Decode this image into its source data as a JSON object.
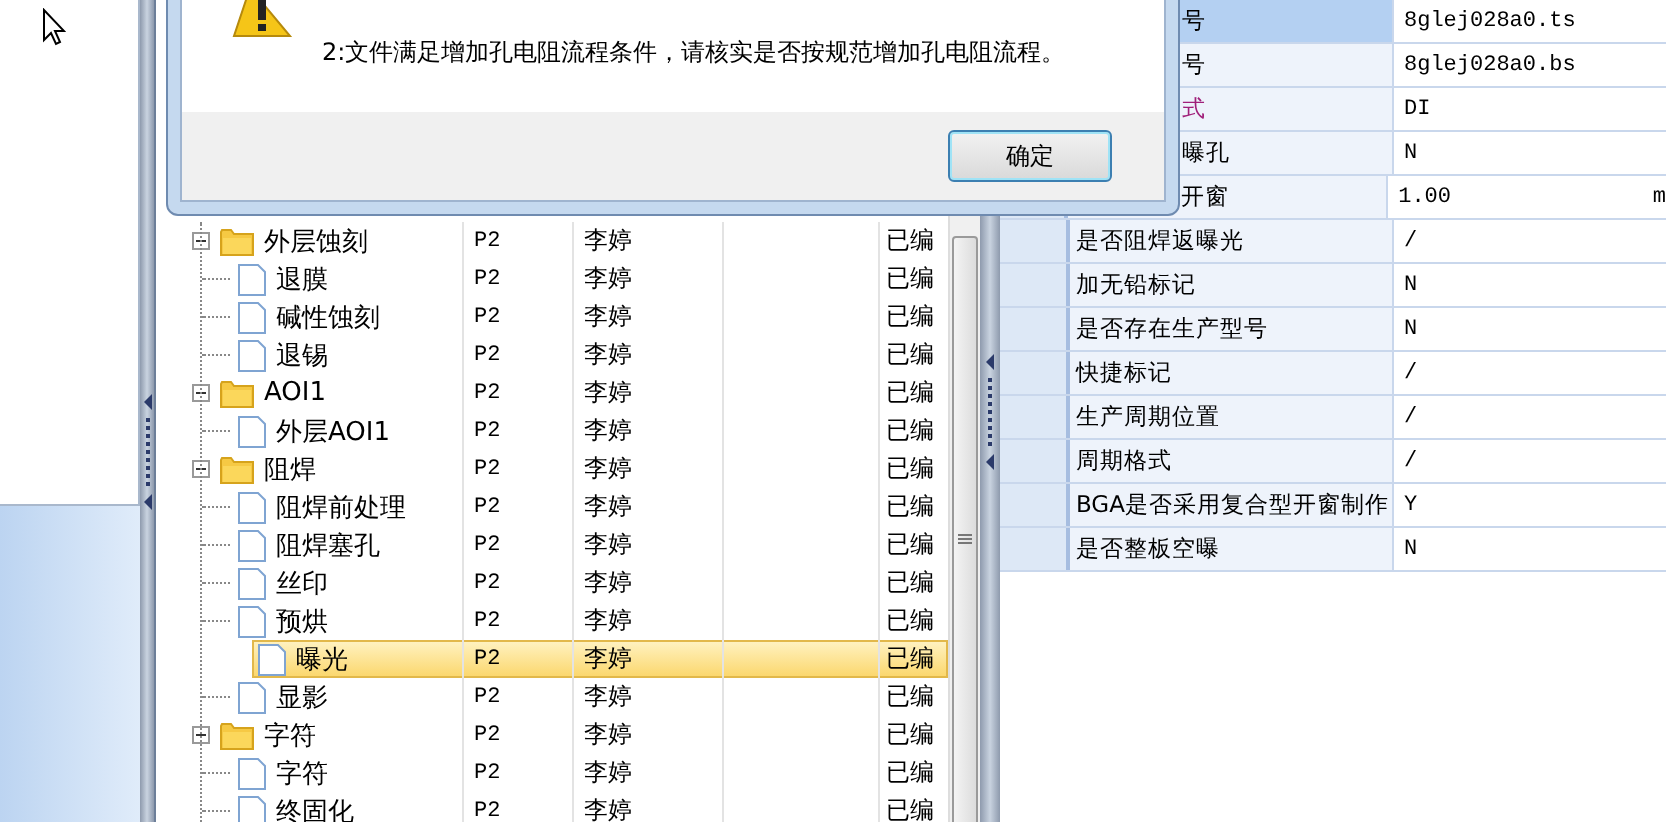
{
  "dialog": {
    "message_lines": [
      "2:文件满足增加孔电阻流程条件，请核实是否按规范增加孔电阻流程。"
    ],
    "buttons": [
      {
        "label": "确定"
      }
    ]
  },
  "tree": [
    {
      "name": "外层蚀刻",
      "layer": "P2",
      "owner": "李婷",
      "status": "已编",
      "expanded": true,
      "selected": false,
      "children": [
        {
          "name": "退膜",
          "layer": "P2",
          "owner": "李婷",
          "status": "已编",
          "selected": false
        },
        {
          "name": "碱性蚀刻",
          "layer": "P2",
          "owner": "李婷",
          "status": "已编",
          "selected": false
        },
        {
          "name": "退锡",
          "layer": "P2",
          "owner": "李婷",
          "status": "已编",
          "selected": false
        }
      ]
    },
    {
      "name": "AOI1",
      "layer": "P2",
      "owner": "李婷",
      "status": "已编",
      "expanded": true,
      "selected": false,
      "children": [
        {
          "name": "外层AOI1",
          "layer": "P2",
          "owner": "李婷",
          "status": "已编",
          "selected": false
        }
      ]
    },
    {
      "name": "阻焊",
      "layer": "P2",
      "owner": "李婷",
      "status": "已编",
      "expanded": true,
      "selected": false,
      "children": [
        {
          "name": "阻焊前处理",
          "layer": "P2",
          "owner": "李婷",
          "status": "已编",
          "selected": false
        },
        {
          "name": "阻焊塞孔",
          "layer": "P2",
          "owner": "李婷",
          "status": "已编",
          "selected": false
        },
        {
          "name": "丝印",
          "layer": "P2",
          "owner": "李婷",
          "status": "已编",
          "selected": false
        },
        {
          "name": "预烘",
          "layer": "P2",
          "owner": "李婷",
          "status": "已编",
          "selected": false
        },
        {
          "name": "曝光",
          "layer": "P2",
          "owner": "李婷",
          "status": "已编",
          "selected": true
        },
        {
          "name": "显影",
          "layer": "P2",
          "owner": "李婷",
          "status": "已编",
          "selected": false
        }
      ]
    },
    {
      "name": "字符",
      "layer": "P2",
      "owner": "李婷",
      "status": "已编",
      "expanded": true,
      "selected": false,
      "children": [
        {
          "name": "字符",
          "layer": "P2",
          "owner": "李婷",
          "status": "已编",
          "selected": false
        },
        {
          "name": "终固化",
          "layer": "P2",
          "owner": "李婷",
          "status": "已编",
          "selected": false
        }
      ]
    }
  ],
  "properties": [
    {
      "name": "号",
      "value": "8glej028a0.ts",
      "selected": true,
      "changed": false
    },
    {
      "name": "号",
      "value": "8glej028a0.bs",
      "selected": false,
      "changed": false
    },
    {
      "name": "式",
      "value": "DI",
      "selected": false,
      "changed": true
    },
    {
      "name": "曝孔",
      "value": "N",
      "selected": false,
      "changed": false
    },
    {
      "name": "开窗",
      "value": "1.00",
      "unit": "m",
      "selected": false,
      "changed": false
    },
    {
      "name": "是否阻焊返曝光",
      "value": "/",
      "selected": false,
      "changed": false
    },
    {
      "name": "加无铅标记",
      "value": "N",
      "selected": false,
      "changed": false
    },
    {
      "name": "是否存在生产型号",
      "value": "N",
      "selected": false,
      "changed": false
    },
    {
      "name": "快捷标记",
      "value": "/",
      "selected": false,
      "changed": false
    },
    {
      "name": "生产周期位置",
      "value": "/",
      "selected": false,
      "changed": false
    },
    {
      "name": "周期格式",
      "value": "/",
      "selected": false,
      "changed": false
    },
    {
      "name": "BGA是否采用复合型开窗制作",
      "value": "Y",
      "selected": false,
      "changed": false
    },
    {
      "name": "是否整板空曝",
      "value": "N",
      "selected": false,
      "changed": false
    }
  ]
}
